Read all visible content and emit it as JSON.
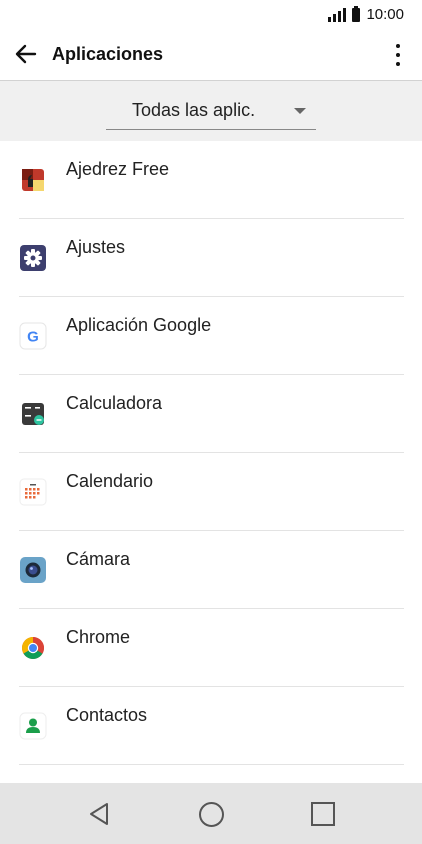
{
  "status_bar": {
    "time": "10:00",
    "icons": [
      "signal-icon",
      "battery-icon"
    ]
  },
  "app_bar": {
    "title": "Aplicaciones",
    "back_icon": "arrow-left-icon",
    "menu_icon": "more-vert-icon"
  },
  "filter": {
    "selected": "Todas las aplic."
  },
  "apps": [
    {
      "label": "Ajedrez Free",
      "icon": "chess-icon",
      "color": "#c0392b"
    },
    {
      "label": "Ajustes",
      "icon": "settings-gear-icon",
      "color": "#3d3f6e"
    },
    {
      "label": "Aplicación Google",
      "icon": "google-g-icon",
      "color": "#4285f4"
    },
    {
      "label": "Calculadora",
      "icon": "calculator-icon",
      "color": "#3a3a3a"
    },
    {
      "label": "Calendario",
      "icon": "calendar-icon",
      "color": "#e86a3a"
    },
    {
      "label": "Cámara",
      "icon": "camera-icon",
      "color": "#6aa3c8"
    },
    {
      "label": "Chrome",
      "icon": "chrome-icon",
      "color": "#db4437"
    },
    {
      "label": "Contactos",
      "icon": "contact-person-icon",
      "color": "#1a9e4a"
    }
  ],
  "nav_bar": {
    "buttons": [
      "back-triangle-icon",
      "home-circle-icon",
      "recent-square-icon"
    ]
  }
}
